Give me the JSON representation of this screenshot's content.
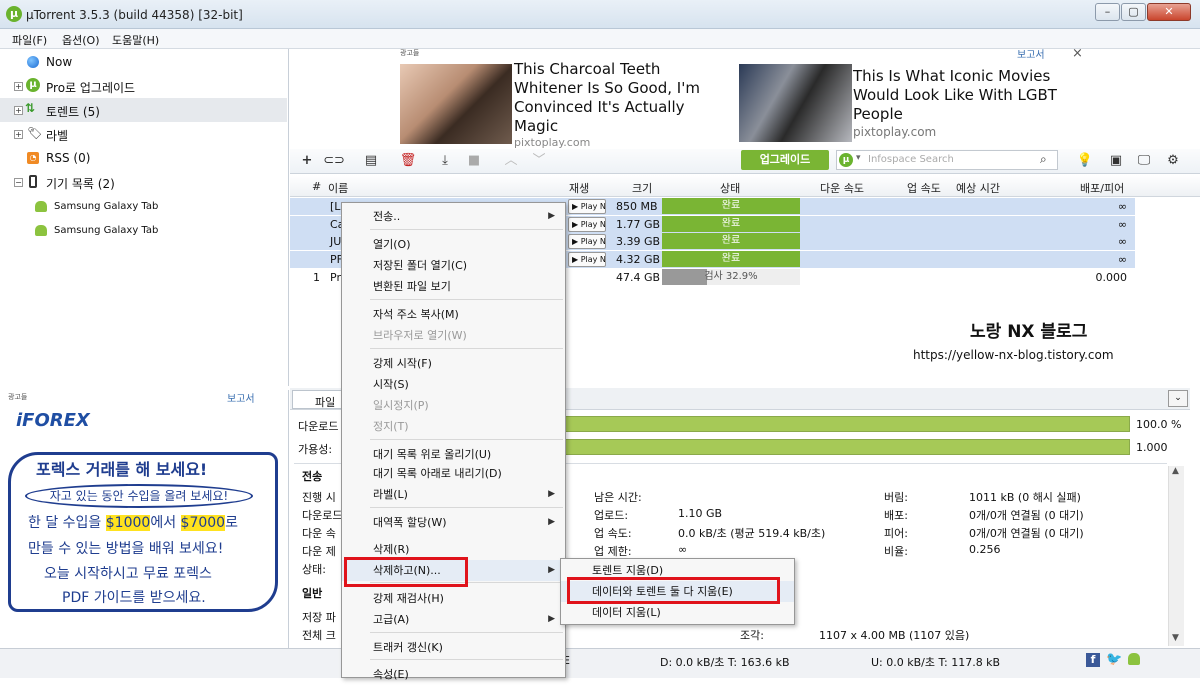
{
  "window": {
    "title": "µTorrent 3.5.3  (build 44358) [32-bit]",
    "logo": "µ"
  },
  "menu": [
    "파일(F)",
    "옵션(O)",
    "도움말(H)"
  ],
  "sidebar": {
    "items": [
      {
        "label": "Now",
        "icon": "globe-icon"
      },
      {
        "label": "Pro로 업그레이드",
        "icon": "utorrent-logo-icon"
      },
      {
        "label": "토렌트 (5)",
        "icon": "torrent-arrows-icon"
      },
      {
        "label": "라벨",
        "icon": "tag-icon"
      },
      {
        "label": "RSS (0)",
        "icon": "rss-icon"
      },
      {
        "label": "기기 목록 (2)",
        "icon": "phone-icon"
      },
      {
        "label": "Samsung Galaxy Tab",
        "icon": "android-icon"
      },
      {
        "label": "Samsung Galaxy Tab",
        "icon": "android-icon"
      }
    ]
  },
  "ad_top": {
    "tag": "광고들",
    "report": "보고서",
    "close": "×",
    "ad1_text": "This Charcoal Teeth Whitener Is So Good, I'm Convinced It's Actually Magic",
    "ad1_source": "pixtoplay.com",
    "ad2_text": "This Is What Iconic Movies Would Look Like With LGBT People",
    "ad2_source": "pixtoplay.com"
  },
  "toolbar": {
    "upgrade": "업그레이드",
    "search_placeholder": "Infospace Search"
  },
  "list": {
    "headers": [
      "#",
      "이름",
      "재생",
      "크기",
      "상태",
      "다운 속도",
      "업 속도",
      "예상 시간",
      "배포/피어"
    ],
    "rows": [
      {
        "num": "",
        "name": "[L",
        "play": "▶ Play N",
        "size": "850 MB",
        "status": "완료",
        "ratio": "∞"
      },
      {
        "num": "",
        "name": "Ca",
        "play": "▶ Play N",
        "size": "1.77 GB",
        "status": "완료",
        "ratio": "∞"
      },
      {
        "num": "",
        "name": "JU",
        "play": "▶ Play N",
        "size": "3.39 GB",
        "status": "완료",
        "ratio": "∞"
      },
      {
        "num": "",
        "name": "PF",
        "play": "▶ Play N",
        "size": "4.32 GB",
        "status": "완료",
        "ratio": "∞"
      },
      {
        "num": "1",
        "name": "Pr",
        "play": "",
        "size": "47.4 GB",
        "status": "검사 32.9%",
        "ratio": "0.000"
      }
    ],
    "row_progress": [
      1,
      1,
      1,
      1,
      0.329
    ]
  },
  "watermark": {
    "title": "노랑 NX 블로그",
    "url": "https://yellow-nx-blog.tistory.com"
  },
  "bottom_ad": {
    "tag": "광고들",
    "report": "보고서",
    "brand": "iFOREX",
    "line1": "포렉스 거래를 해 보세요!",
    "line2": "자고 있는 동안 수입을 올려 보세요!",
    "line3_a": "한 달 수입을 ",
    "line3_b": "$1000",
    "line3_c": "에서 ",
    "line3_d": "$7000",
    "line3_e": "로",
    "line4": "만들 수 있는 방법을 배워 보세요!",
    "line5": "오늘 시작하시고 무료 포렉스",
    "line6": "PDF 가이드를 받으세요."
  },
  "details": {
    "tab": "파일",
    "download_label": "다운로드",
    "avail_label": "가용성:",
    "download_pct": "100.0 %",
    "avail_val": "1.000",
    "transfer_head": "전송",
    "left_labels": [
      "진행 시",
      "다운로드",
      "다운 속",
      "다운 제",
      "상태:"
    ],
    "general_head": "일반",
    "general_labels": [
      "저장 파",
      "전체 크"
    ],
    "mid": [
      {
        "label": "남은 시간:",
        "value": ""
      },
      {
        "label": "업로드:",
        "value": "1.10 GB"
      },
      {
        "label": "업 속도:",
        "value": "0.0 kB/초 (평균 519.4 kB/초)"
      },
      {
        "label": "업 제한:",
        "value": "∞"
      }
    ],
    "right": [
      {
        "label": "버림:",
        "value": "1011 kB (0 해시 실패)"
      },
      {
        "label": "배포:",
        "value": "0개/0개 연결됨 (0 대기)"
      },
      {
        "label": "피어:",
        "value": "0개/0개 연결됨 (0 대기)"
      },
      {
        "label": "비율:",
        "value": "0.256"
      }
    ],
    "pieces_label": "조각:",
    "pieces_value": "1107 x 4.00 MB (1107 있음)"
  },
  "status": {
    "dht": "E",
    "down": "D: 0.0 kB/초 T: 163.6 kB",
    "up": "U: 0.0 kB/초 T: 117.8 kB"
  },
  "context_menu": {
    "items": [
      "전송..",
      "열기(O)",
      "저장된 폴더 열기(C)",
      "변환된 파일 보기",
      "자석 주소 복사(M)",
      "브라우저로 열기(W)",
      "강제 시작(F)",
      "시작(S)",
      "일시정지(P)",
      "정지(T)",
      "대기 목록 위로 올리기(U)",
      "대기 목록 아래로 내리기(D)",
      "라벨(L)",
      "대역폭 할당(W)",
      "삭제(R)",
      "삭제하고(N)...",
      "강제 재검사(H)",
      "고급(A)",
      "트래커 갱신(K)",
      "속성(E)"
    ]
  },
  "submenu": {
    "items": [
      "토렌트 지움(D)",
      "데이터와 토렌트 둘 다 지움(E)",
      "데이터 지움(L)"
    ]
  },
  "colors": {
    "accent_green": "#7ab534",
    "highlight_red": "#e0131b",
    "selection": "#cfdef3"
  }
}
